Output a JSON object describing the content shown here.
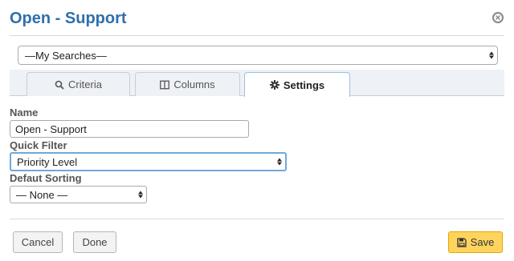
{
  "dialog": {
    "title": "Open - Support"
  },
  "searches": {
    "selected": "—My Searches—"
  },
  "tabs": [
    {
      "label": "Criteria",
      "icon": "search-icon"
    },
    {
      "label": "Columns",
      "icon": "columns-icon"
    },
    {
      "label": "Settings",
      "icon": "gear-icon",
      "active": true
    }
  ],
  "form": {
    "name_label": "Name",
    "name_value": "Open - Support",
    "quick_filter_label": "Quick Filter",
    "quick_filter_value": "Priority Level",
    "sorting_label": "Defaut Sorting",
    "sorting_value": "— None —"
  },
  "footer": {
    "cancel_label": "Cancel",
    "done_label": "Done",
    "save_label": "Save"
  },
  "colors": {
    "title": "#2f6fab",
    "save_button": "#ffd45e",
    "focus_border": "#6fa8dc"
  }
}
